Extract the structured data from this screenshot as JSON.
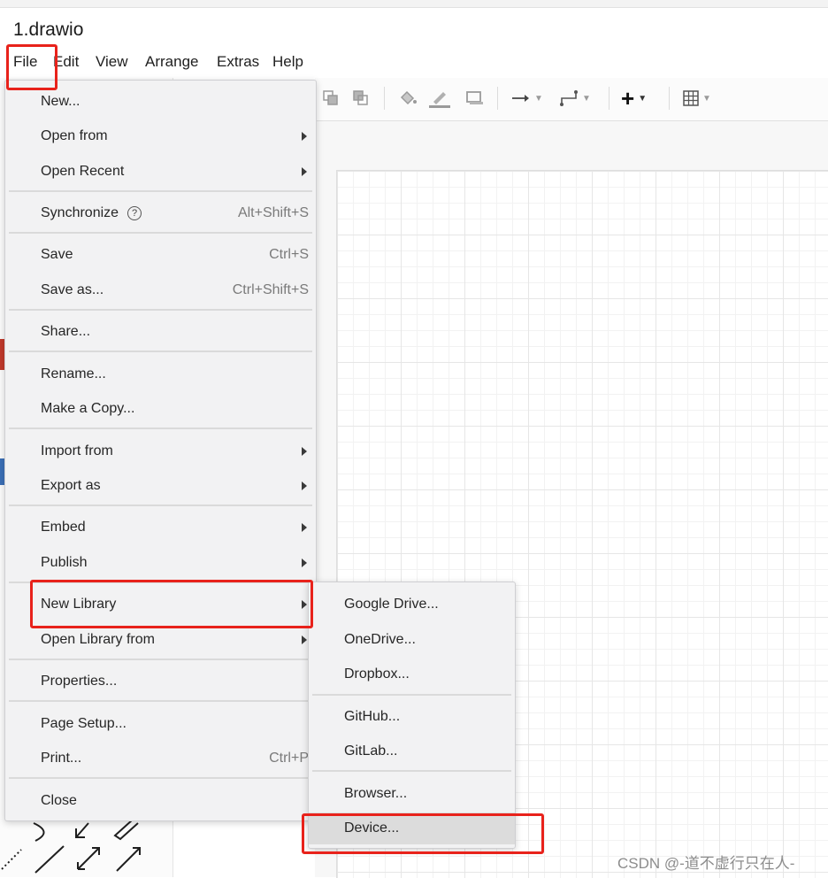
{
  "window": {
    "title": "1.drawio"
  },
  "menubar": [
    "File",
    "Edit",
    "View",
    "Arrange",
    "Extras",
    "Help"
  ],
  "file_menu": {
    "groups": [
      [
        {
          "label": "New...",
          "submenu": false
        },
        {
          "label": "Open from",
          "submenu": true
        },
        {
          "label": "Open Recent",
          "submenu": true
        }
      ],
      [
        {
          "label": "Synchronize",
          "shortcut": "Alt+Shift+S",
          "help": "?"
        }
      ],
      [
        {
          "label": "Save",
          "shortcut": "Ctrl+S"
        },
        {
          "label": "Save as...",
          "shortcut": "Ctrl+Shift+S"
        }
      ],
      [
        {
          "label": "Share..."
        }
      ],
      [
        {
          "label": "Rename..."
        },
        {
          "label": "Make a Copy..."
        }
      ],
      [
        {
          "label": "Import from",
          "submenu": true
        },
        {
          "label": "Export as",
          "submenu": true
        }
      ],
      [
        {
          "label": "Embed",
          "submenu": true
        },
        {
          "label": "Publish",
          "submenu": true
        }
      ],
      [
        {
          "label": "New Library",
          "submenu": true,
          "highlighted": true
        },
        {
          "label": "Open Library from",
          "submenu": true
        }
      ],
      [
        {
          "label": "Properties..."
        }
      ],
      [
        {
          "label": "Page Setup..."
        },
        {
          "label": "Print...",
          "shortcut": "Ctrl+P"
        }
      ],
      [
        {
          "label": "Close"
        }
      ]
    ]
  },
  "new_library_submenu": {
    "groups": [
      [
        {
          "label": "Google Drive..."
        },
        {
          "label": "OneDrive..."
        },
        {
          "label": "Dropbox..."
        }
      ],
      [
        {
          "label": "GitHub..."
        },
        {
          "label": "GitLab..."
        }
      ],
      [
        {
          "label": "Browser..."
        },
        {
          "label": "Device...",
          "highlighted": true
        }
      ]
    ]
  },
  "toolbar": {
    "icons": [
      "to-front-icon",
      "to-back-icon",
      "fill-color-icon",
      "line-color-icon",
      "shadow-icon",
      "connection-arrow-icon",
      "waypoints-icon",
      "insert-plus-icon",
      "table-icon"
    ]
  },
  "watermark": "CSDN @-道不虚行只在人-",
  "colors": {
    "highlight_red": "#e8221b",
    "menu_bg": "#f2f2f3",
    "selected_bg": "#dcdcdc"
  }
}
